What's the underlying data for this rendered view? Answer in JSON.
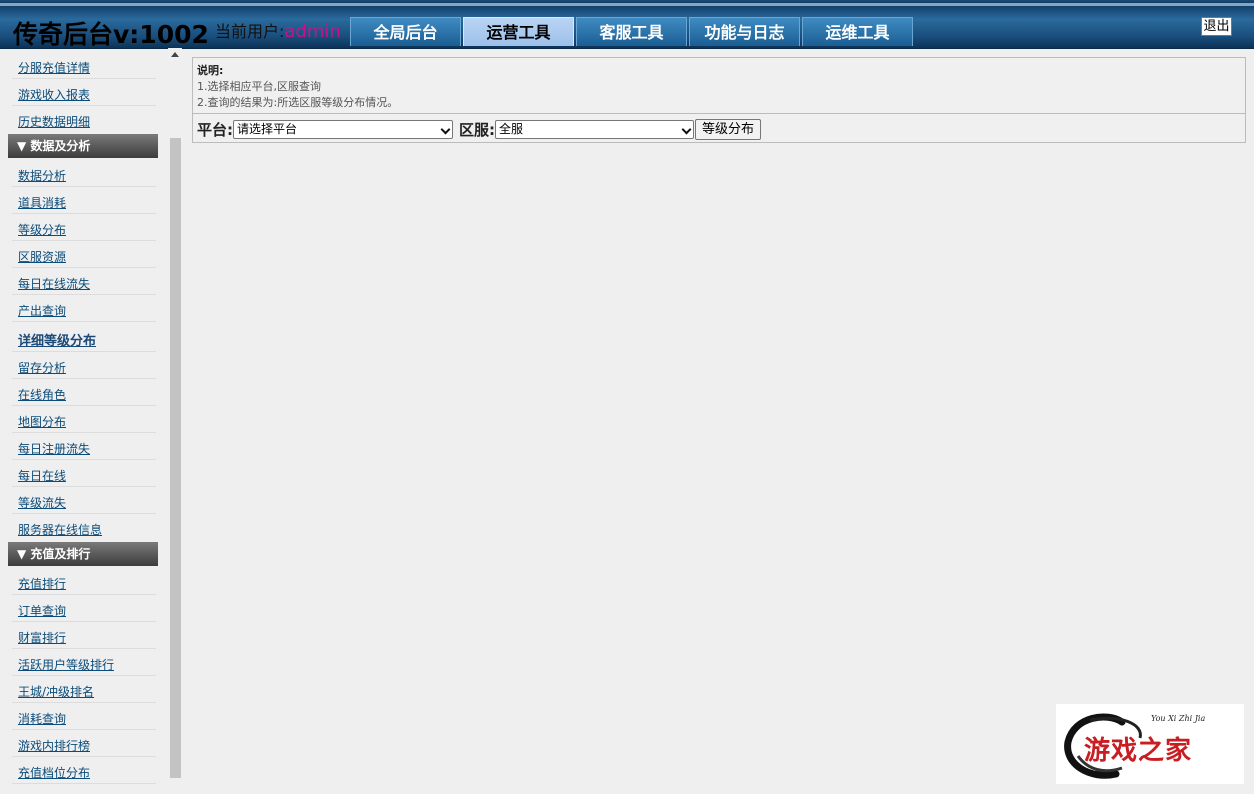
{
  "header": {
    "title": "传奇后台v:1002",
    "user_label": "当前用户:",
    "user_name": "admin",
    "tabs": [
      "全局后台",
      "运营工具",
      "客服工具",
      "功能与日志",
      "运维工具"
    ],
    "active_tab": "运营工具",
    "logout": "退出"
  },
  "sidebar": {
    "items_top": [
      "分服充值详情",
      "游戏收入报表",
      "历史数据明细"
    ],
    "group_data": {
      "label": "▼ 数据及分析",
      "items": [
        "数据分析",
        "道具消耗",
        "等级分布",
        "区服资源",
        "每日在线流失",
        "产出查询",
        "详细等级分布",
        "留存分析",
        "在线角色",
        "地图分布",
        "每日注册流失",
        "每日在线",
        "等级流失",
        "服务器在线信息"
      ],
      "active_item": "详细等级分布"
    },
    "group_recharge": {
      "label": "▼ 充值及排行",
      "items": [
        "充值排行",
        "订单查询",
        "财富排行",
        "活跃用户等级排行",
        "王城/冲级排名",
        "消耗查询",
        "游戏内排行榜",
        "充值档位分布"
      ]
    }
  },
  "main": {
    "desc_title": "说明:",
    "desc_lines": [
      "1.选择相应平台,区服查询",
      "2.查询的结果为:所选区服等级分布情况。"
    ],
    "platform_label": "平台:",
    "platform_value": "请选择平台",
    "server_label": "区服:",
    "server_value": "全服",
    "button": "等级分布"
  },
  "watermark": {
    "text": "游戏之家",
    "pinyin": "You Xi Zhi Jia"
  },
  "colors": {
    "header_blue": "#1a4f7e",
    "tab_blue": "#2b72aa",
    "tab_active": "#a9c8ee",
    "user_pink": "#c8128a",
    "link_blue": "#0c4c7a",
    "group_gray": "#555555",
    "watermark_red": "#c81d22"
  }
}
